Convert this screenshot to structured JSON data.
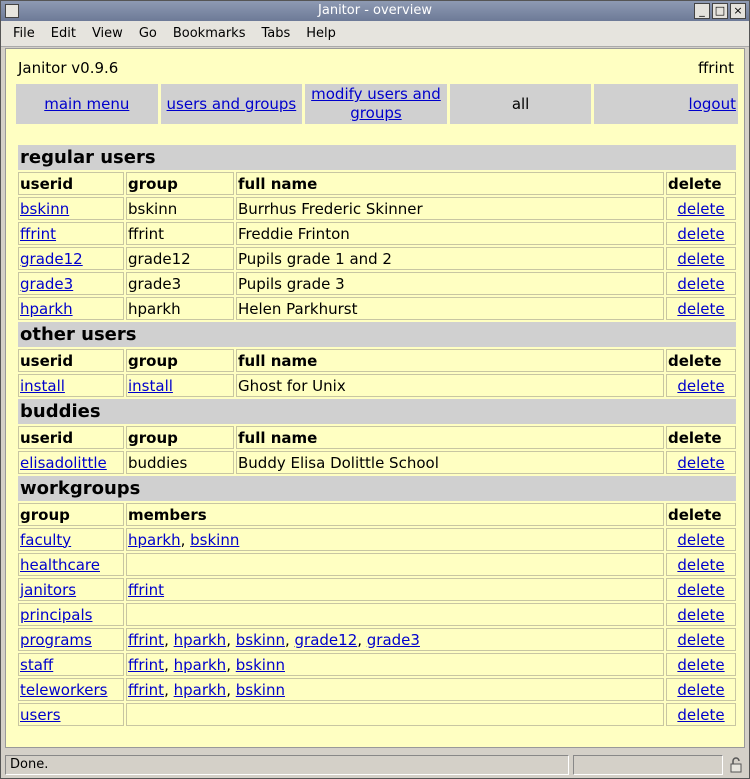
{
  "window": {
    "title": "Janitor - overview",
    "buttons": [
      "_",
      "□",
      "×"
    ]
  },
  "menu": [
    "File",
    "Edit",
    "View",
    "Go",
    "Bookmarks",
    "Tabs",
    "Help"
  ],
  "header": {
    "version": "Janitor v0.9.6",
    "user": "ffrint"
  },
  "nav": [
    {
      "label": "main menu",
      "link": true
    },
    {
      "label": "users and groups",
      "link": true
    },
    {
      "label": "modify users and groups",
      "link": true
    },
    {
      "label": "all",
      "link": false
    },
    {
      "label": "logout",
      "link": true
    }
  ],
  "sections": [
    {
      "title": "regular users",
      "headers": [
        "userid",
        "group",
        "full name",
        "delete"
      ],
      "rows": [
        {
          "userid": "bskinn",
          "group": "bskinn",
          "group_link": false,
          "fullname": "Burrhus Frederic Skinner"
        },
        {
          "userid": "ffrint",
          "group": "ffrint",
          "group_link": false,
          "fullname": "Freddie Frinton"
        },
        {
          "userid": "grade12",
          "group": "grade12",
          "group_link": false,
          "fullname": "Pupils grade 1 and 2"
        },
        {
          "userid": "grade3",
          "group": "grade3",
          "group_link": false,
          "fullname": "Pupils grade 3"
        },
        {
          "userid": "hparkh",
          "group": "hparkh",
          "group_link": false,
          "fullname": "Helen Parkhurst"
        }
      ]
    },
    {
      "title": "other users",
      "headers": [
        "userid",
        "group",
        "full name",
        "delete"
      ],
      "rows": [
        {
          "userid": "install",
          "group": "install",
          "group_link": true,
          "fullname": "Ghost for Unix"
        }
      ]
    },
    {
      "title": "buddies",
      "headers": [
        "userid",
        "group",
        "full name",
        "delete"
      ],
      "rows": [
        {
          "userid": "elisadolittle",
          "group": "buddies",
          "group_link": false,
          "fullname": "Buddy Elisa Dolittle School"
        }
      ]
    }
  ],
  "workgroups": {
    "title": "workgroups",
    "headers": [
      "group",
      "members",
      "delete"
    ],
    "rows": [
      {
        "group": "faculty",
        "members": [
          "hparkh",
          "bskinn"
        ]
      },
      {
        "group": "healthcare",
        "members": []
      },
      {
        "group": "janitors",
        "members": [
          "ffrint"
        ]
      },
      {
        "group": "principals",
        "members": []
      },
      {
        "group": "programs",
        "members": [
          "ffrint",
          "hparkh",
          "bskinn",
          "grade12",
          "grade3"
        ]
      },
      {
        "group": "staff",
        "members": [
          "ffrint",
          "hparkh",
          "bskinn"
        ]
      },
      {
        "group": "teleworkers",
        "members": [
          "ffrint",
          "hparkh",
          "bskinn"
        ]
      },
      {
        "group": "users",
        "members": []
      }
    ]
  },
  "delete_label": "delete",
  "member_separator": ", ",
  "status": "Done.",
  "icons": {
    "lock": "lock-icon",
    "window": "window-icon"
  },
  "colors": {
    "page_bg": "#ffffc2",
    "section_bg": "#d0d0d0",
    "link": "#0000cc"
  }
}
